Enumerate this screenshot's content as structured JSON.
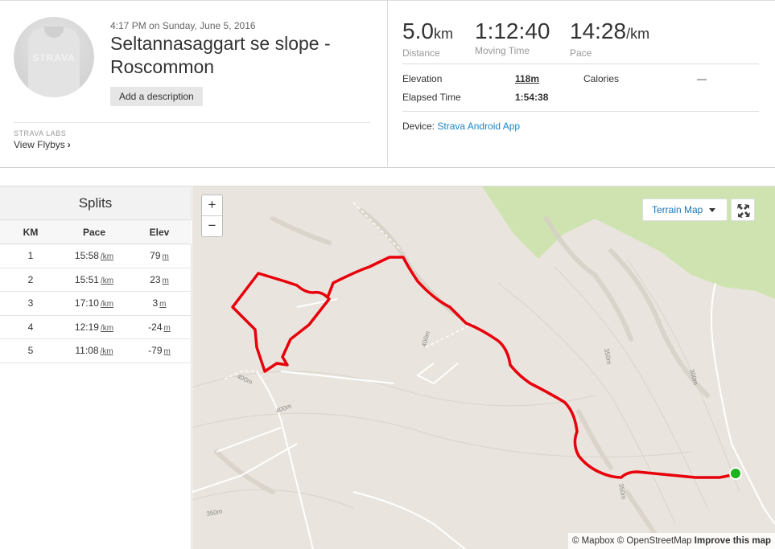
{
  "activity": {
    "date": "4:17 PM on Sunday, June 5, 2016",
    "title": "Seltannasaggart se slope - Roscommon",
    "add_description": "Add a description",
    "avatar_logo": "STRAVA",
    "labs_label": "STRAVA LABS",
    "flyby_label": "View Flybys",
    "flyby_chevron": "›"
  },
  "stats": {
    "distance": {
      "value": "5.0",
      "unit": "km",
      "label": "Distance"
    },
    "moving_time": {
      "value": "1:12:40",
      "label": "Moving Time"
    },
    "pace": {
      "value": "14:28",
      "unit": "/km",
      "label": "Pace"
    },
    "elevation_label": "Elevation",
    "elevation_value": "118m",
    "calories_label": "Calories",
    "calories_value": "—",
    "elapsed_label": "Elapsed Time",
    "elapsed_value": "1:54:38",
    "device_label": "Device:",
    "device_value": "Strava Android App"
  },
  "splits": {
    "title": "Splits",
    "headers": [
      "KM",
      "Pace",
      "Elev"
    ],
    "pace_unit": "/km",
    "elev_unit": "m",
    "rows": [
      {
        "km": "1",
        "pace": "15:58",
        "elev": "79"
      },
      {
        "km": "2",
        "pace": "15:51",
        "elev": "23"
      },
      {
        "km": "3",
        "pace": "17:10",
        "elev": "3"
      },
      {
        "km": "4",
        "pace": "12:19",
        "elev": "-24"
      },
      {
        "km": "5",
        "pace": "11:08",
        "elev": "-79"
      }
    ]
  },
  "map": {
    "zoom_in": "+",
    "zoom_out": "−",
    "map_type": "Terrain Map",
    "contour_labels": [
      "400m",
      "400m",
      "400m",
      "350m",
      "350m",
      "350m",
      "300m"
    ],
    "attribution_mapbox": "© Mapbox",
    "attribution_osm": "© OpenStreetMap",
    "improve": "Improve this map",
    "route_color": "#e8000b",
    "start_color": "#1db31d",
    "land_color": "#e9e5de",
    "park_color": "#cfe3b0"
  }
}
